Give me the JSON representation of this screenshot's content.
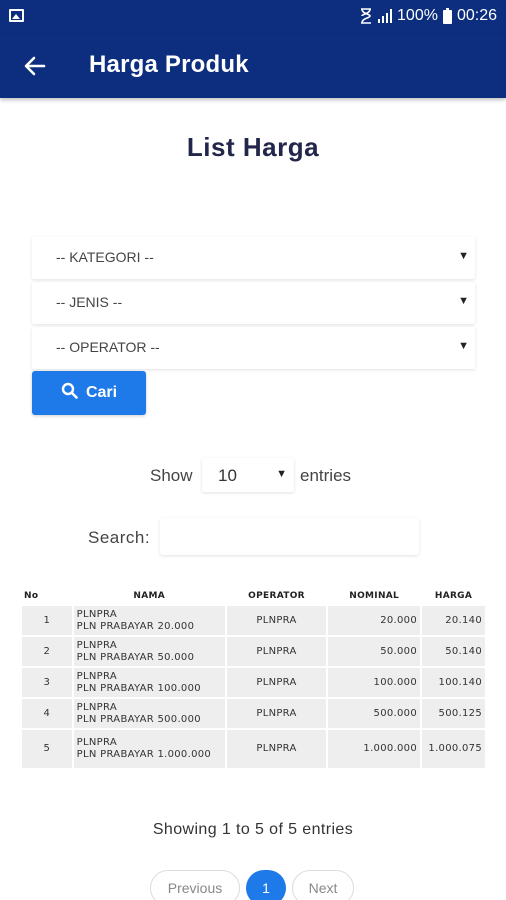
{
  "status_bar": {
    "battery": "100%",
    "time": "00:26"
  },
  "app_bar": {
    "title": "Harga Produk"
  },
  "heading": "List Harga",
  "filters": {
    "kategori": "-- KATEGORI --",
    "jenis": "-- JENIS --",
    "operator": "-- OPERATOR --"
  },
  "search_button": {
    "label": "Cari"
  },
  "entries": {
    "show_label": "Show",
    "value": "10",
    "suffix": "entries"
  },
  "search": {
    "label": "Search:",
    "value": ""
  },
  "table": {
    "headers": [
      "No",
      "NAMA",
      "OPERATOR",
      "NOMINAL",
      "HARGA"
    ],
    "rows": [
      {
        "no": "1",
        "nama_code": "PLNPRA",
        "nama_desc": "PLN PRABAYAR 20.000",
        "operator": "PLNPRA",
        "nominal": "20.000",
        "harga": "20.140"
      },
      {
        "no": "2",
        "nama_code": "PLNPRA",
        "nama_desc": "PLN PRABAYAR 50.000",
        "operator": "PLNPRA",
        "nominal": "50.000",
        "harga": "50.140"
      },
      {
        "no": "3",
        "nama_code": "PLNPRA",
        "nama_desc": "PLN PRABAYAR 100.000",
        "operator": "PLNPRA",
        "nominal": "100.000",
        "harga": "100.140"
      },
      {
        "no": "4",
        "nama_code": "PLNPRA",
        "nama_desc": "PLN PRABAYAR 500.000",
        "operator": "PLNPRA",
        "nominal": "500.000",
        "harga": "500.125"
      },
      {
        "no": "5",
        "nama_code": "PLNPRA",
        "nama_desc": "PLN PRABAYAR 1.000.000",
        "operator": "PLNPRA",
        "nominal": "1.000.000",
        "harga": "1.000.075"
      }
    ]
  },
  "info_text": "Showing 1 to 5 of 5 entries",
  "pagination": {
    "previous": "Previous",
    "current": "1",
    "next": "Next"
  },
  "colors": {
    "app_bar": "#0d2e7e",
    "accent": "#1e7ae8",
    "heading": "#22264a"
  }
}
